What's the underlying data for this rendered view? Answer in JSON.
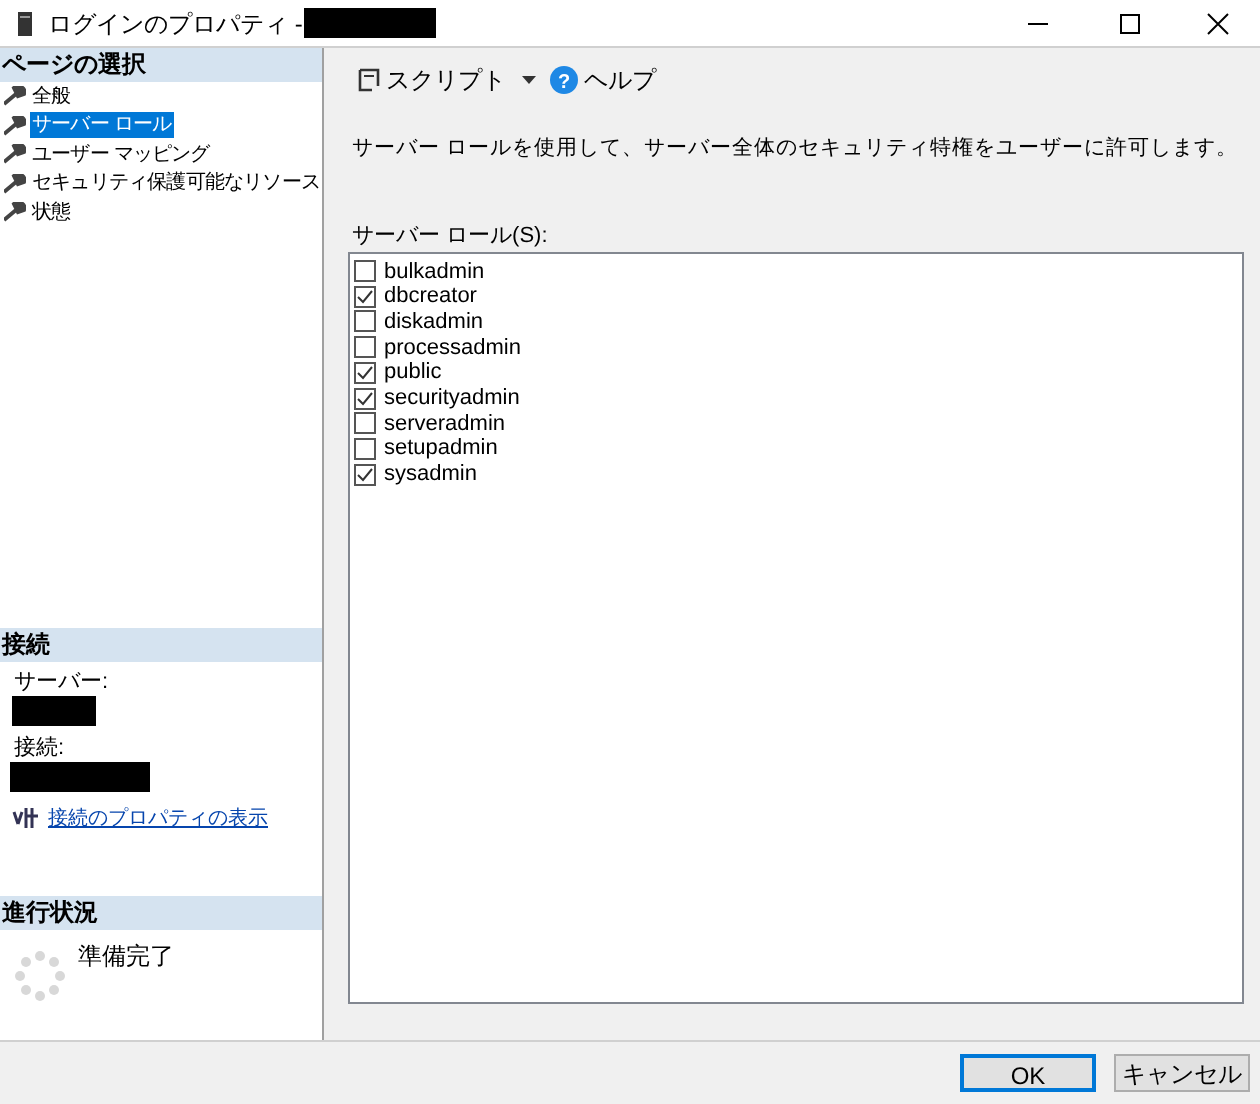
{
  "window": {
    "title": "ログインのプロパティ -",
    "title_redacted": true
  },
  "page_select": {
    "header": "ページの選択",
    "items": [
      {
        "label": "全般",
        "selected": false
      },
      {
        "label": "サーバー ロール",
        "selected": true
      },
      {
        "label": "ユーザー マッピング",
        "selected": false
      },
      {
        "label": "セキュリティ保護可能なリソース",
        "selected": false
      },
      {
        "label": "状態",
        "selected": false
      }
    ]
  },
  "connection": {
    "header": "接続",
    "server_label": "サーバー:",
    "server_redacted": true,
    "connection_label": "接続:",
    "connection_redacted": true,
    "link": "接続のプロパティの表示"
  },
  "progress": {
    "header": "進行状況",
    "status": "準備完了"
  },
  "toolbar": {
    "script": "スクリプト",
    "help": "ヘルプ",
    "help_icon": "?"
  },
  "description": "サーバー ロールを使用して、サーバー全体のセキュリティ特権をユーザーに許可します。",
  "roles_label": "サーバー ロール(S):",
  "roles": [
    {
      "name": "bulkadmin",
      "checked": false
    },
    {
      "name": "dbcreator",
      "checked": true
    },
    {
      "name": "diskadmin",
      "checked": false
    },
    {
      "name": "processadmin",
      "checked": false
    },
    {
      "name": "public",
      "checked": true
    },
    {
      "name": "securityadmin",
      "checked": true
    },
    {
      "name": "serveradmin",
      "checked": false
    },
    {
      "name": "setupadmin",
      "checked": false
    },
    {
      "name": "sysadmin",
      "checked": true
    }
  ],
  "buttons": [
    {
      "label": "OK",
      "default": true
    },
    {
      "label": "キャンセル",
      "default": false
    }
  ]
}
